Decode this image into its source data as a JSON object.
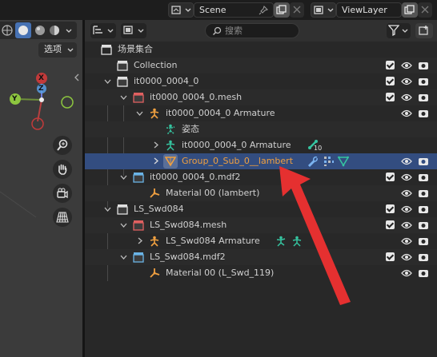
{
  "scene": {
    "label": "Scene"
  },
  "viewlayer": {
    "label": "ViewLayer"
  },
  "viewport": {
    "options_label": "选项",
    "gizmo_axes": [
      "X",
      "Y",
      "Z"
    ]
  },
  "outliner": {
    "search_placeholder": "搜索",
    "rows": [
      {
        "label": "场景集合",
        "icon": "scene-collection-icon"
      },
      {
        "label": "Collection",
        "icon": "collection-icon"
      },
      {
        "label": "it0000_0004_0",
        "icon": "collection-icon"
      },
      {
        "label": "it0000_0004_0.mesh",
        "icon": "collection-red-icon"
      },
      {
        "label": "it0000_0004_0 Armature",
        "icon": "armature-icon"
      },
      {
        "label": "姿态",
        "icon": "pose-icon"
      },
      {
        "label": "it0000_0004_0 Armature",
        "icon": "armature-data-icon",
        "badge": "10"
      },
      {
        "label": "Group_0_Sub_0__lambert",
        "icon": "mesh-object-icon"
      },
      {
        "label": "it0000_0004_0.mdf2",
        "icon": "collection-blue-icon"
      },
      {
        "label": "Material 00 (lambert)",
        "icon": "material-icon"
      },
      {
        "label": "LS_Swd084",
        "icon": "collection-icon"
      },
      {
        "label": "LS_Swd084.mesh",
        "icon": "collection-red-icon"
      },
      {
        "label": "LS_Swd084 Armature",
        "icon": "armature-icon"
      },
      {
        "label": "LS_Swd084.mdf2",
        "icon": "collection-blue-icon"
      },
      {
        "label": "Material 00 (L_Swd_119)",
        "icon": "material-icon"
      }
    ]
  },
  "colors": {
    "selected_row": "#334d80",
    "selected_text": "#f0a040",
    "annotation_arrow": "#e53030"
  }
}
